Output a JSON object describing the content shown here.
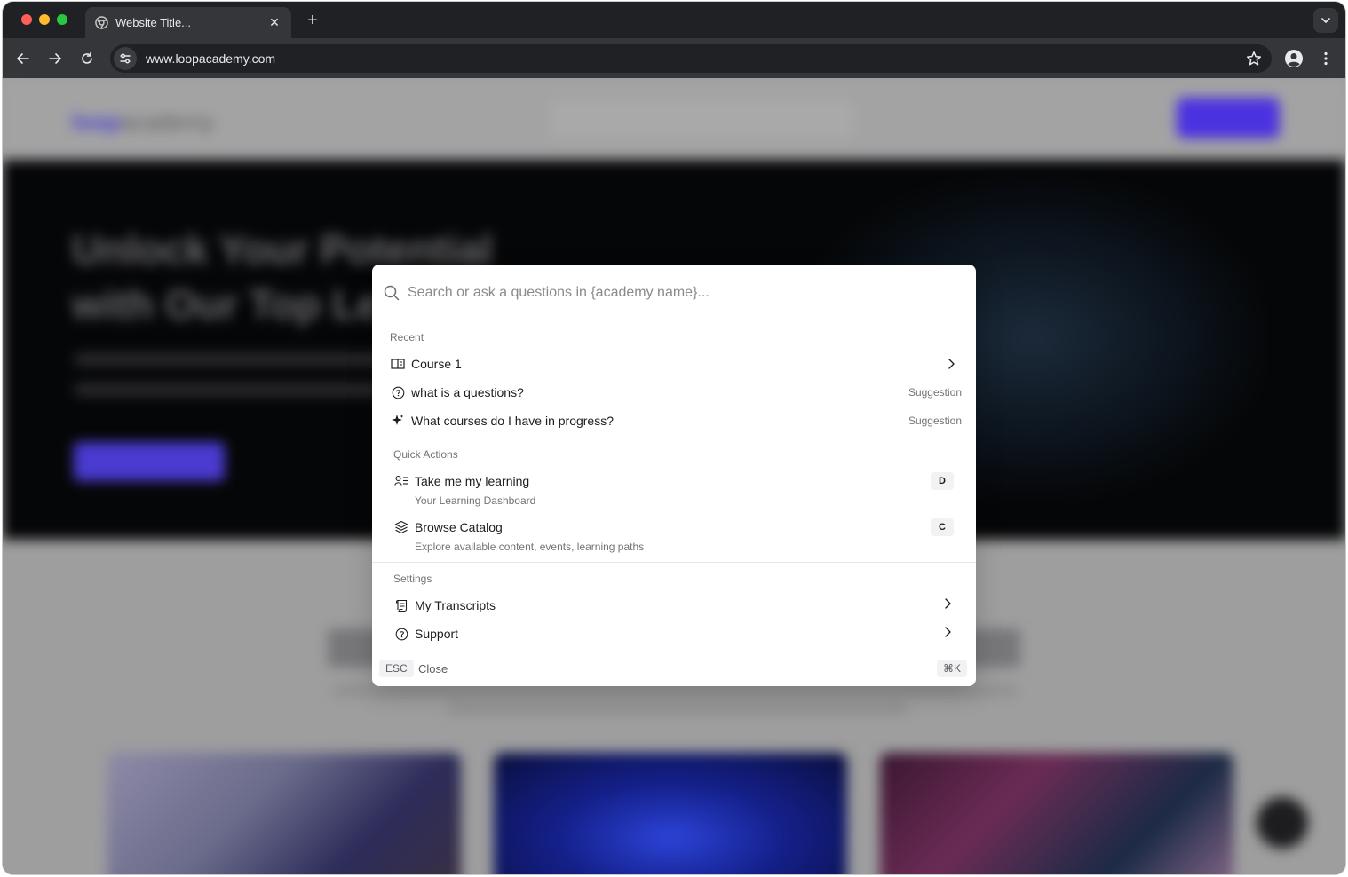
{
  "browser": {
    "tab_title": "Website Title...",
    "tab_close": "✕",
    "new_tab": "+",
    "url": "www.loopacademy.com"
  },
  "background_page": {
    "logo_brand": "loop",
    "logo_rest": "academy",
    "hero_heading": "Unlock Your Potential with Our Top Le"
  },
  "palette": {
    "search_placeholder": "Search or ask a questions in {academy name}...",
    "recent": {
      "label": "Recent",
      "items": [
        {
          "label": "Course 1",
          "icon": "book-icon"
        },
        {
          "label": "what is a questions?",
          "tag": "Suggestion",
          "icon": "question-circle-icon"
        },
        {
          "label": "What courses do I have in progress?",
          "tag": "Suggestion",
          "icon": "sparkle-icon"
        }
      ]
    },
    "quick_actions": {
      "label": "Quick Actions",
      "items": [
        {
          "label": "Take me my learning",
          "description": "Your Learning Dashboard",
          "shortcut": "D",
          "icon": "user-list-icon"
        },
        {
          "label": "Browse Catalog",
          "description": "Explore available content, events, learning paths",
          "shortcut": "C",
          "icon": "layers-icon"
        }
      ]
    },
    "settings": {
      "label": "Settings",
      "items": [
        {
          "label": "My Transcripts",
          "icon": "scroll-icon"
        },
        {
          "label": "Support",
          "icon": "question-circle-icon"
        }
      ]
    },
    "footer": {
      "esc_key": "ESC",
      "close_label": "Close",
      "shortcut": "⌘K"
    }
  },
  "colors": {
    "browser_chrome": "#35363a",
    "tab_strip": "#202124",
    "brand_accent": "#4b32e0",
    "palette_bg": "#ffffff",
    "muted_text": "#737378"
  }
}
